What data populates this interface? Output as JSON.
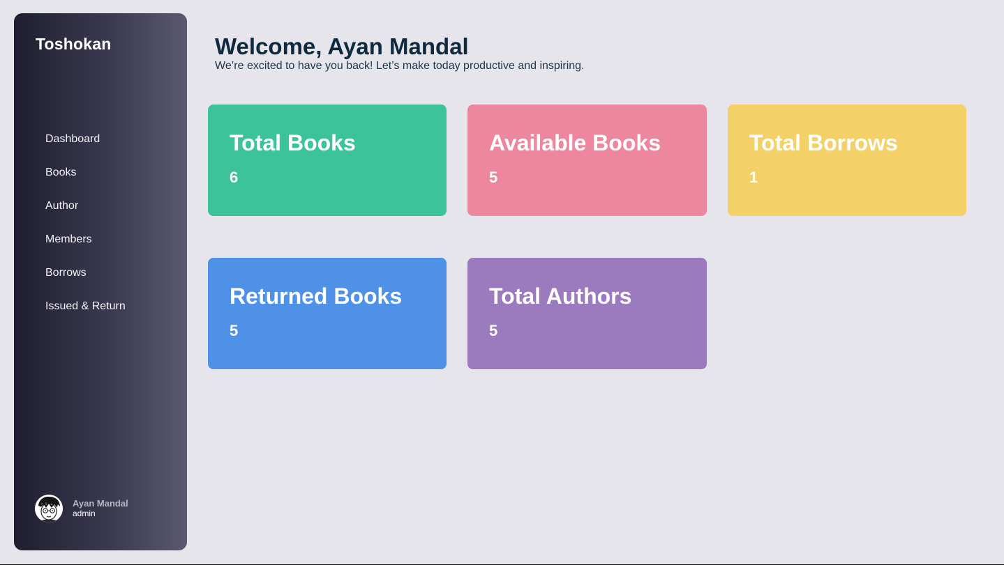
{
  "app": {
    "name": "Toshokan"
  },
  "sidebar": {
    "items": [
      {
        "label": "Dashboard"
      },
      {
        "label": "Books"
      },
      {
        "label": "Author"
      },
      {
        "label": "Members"
      },
      {
        "label": "Borrows"
      },
      {
        "label": "Issued & Return"
      }
    ]
  },
  "user": {
    "name": "Ayan Mandal",
    "role": "admin"
  },
  "header": {
    "title": "Welcome, Ayan Mandal",
    "subtitle": "We’re excited to have you back! Let’s make today productive and inspiring."
  },
  "cards": [
    {
      "title": "Total Books",
      "value": "6",
      "color": "#3dc399"
    },
    {
      "title": "Available Books",
      "value": "5",
      "color": "#ec879f"
    },
    {
      "title": "Total Borrows",
      "value": "1",
      "color": "#f4d068"
    },
    {
      "title": "Returned Books",
      "value": "5",
      "color": "#4f91e6"
    },
    {
      "title": "Total Authors",
      "value": "5",
      "color": "#9b7bbd"
    }
  ],
  "colors": {
    "background": "#e5e5eb",
    "sidebar_start": "#1f1e30",
    "sidebar_end": "#5a596f",
    "heading": "#0f2a3e"
  },
  "icons": {
    "avatar": "user-avatar-illustration"
  }
}
